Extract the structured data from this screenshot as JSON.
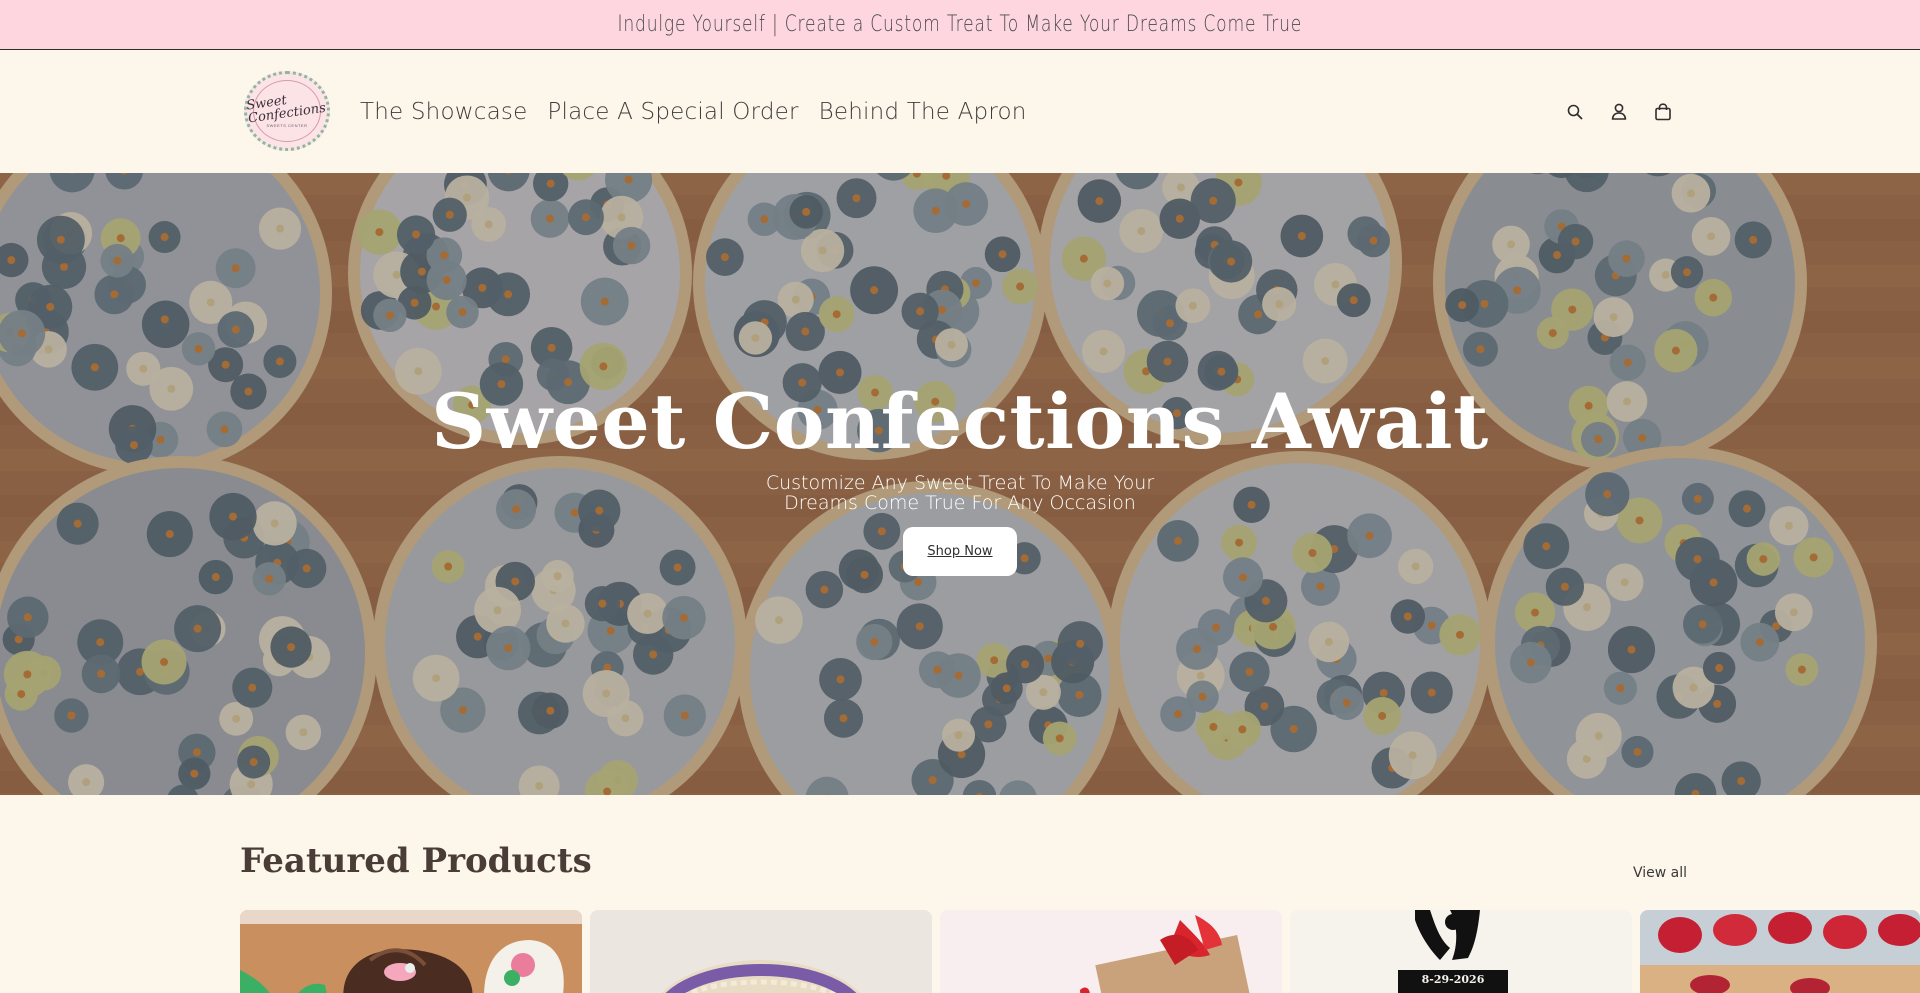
{
  "announcement": {
    "text": "Indulge Yourself | Create a Custom Treat To Make Your Dreams Come True"
  },
  "logo": {
    "script": "Sweet Confections",
    "subtitle": "SWEETS CENTER"
  },
  "nav": {
    "items": [
      "The Showcase",
      "Place A Special Order",
      "Behind The Apron"
    ]
  },
  "header_icons": [
    "search-icon",
    "account-icon",
    "cart-icon"
  ],
  "hero": {
    "title": "Sweet Confections Await",
    "subtitle": "Customize Any Sweet Treat To Make Your Dreams Come True For Any Occasion",
    "button": "Shop Now"
  },
  "featured": {
    "heading": "Featured Products",
    "view_all": "View all",
    "card_date_text": "8-29-2026"
  },
  "colors": {
    "announcement_bg": "#fdd6df",
    "page_bg": "#fdf6ea",
    "heading_brown": "#4a3c37"
  }
}
